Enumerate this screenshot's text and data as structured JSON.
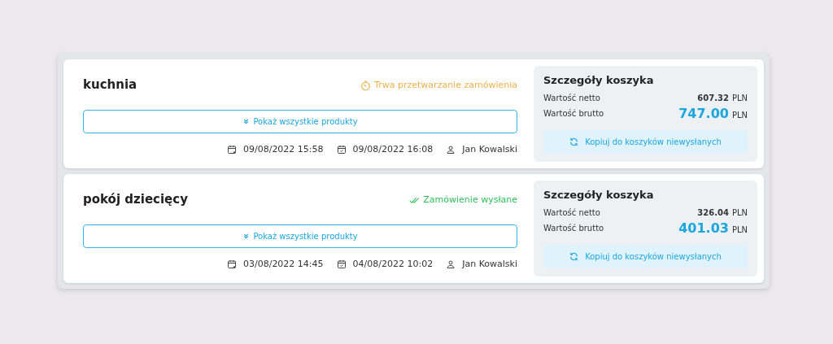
{
  "orders": [
    {
      "name": "kuchnia",
      "status": {
        "kind": "processing",
        "label": "Trwa przetwarzanie zamówienia"
      },
      "show_products": "Pokaż wszystkie produkty",
      "created": "09/08/2022 15:58",
      "sent": "09/08/2022 16:08",
      "user": "Jan Kowalski",
      "basket": {
        "title": "Szczegóły koszyka",
        "net_label": "Wartość netto",
        "net_value": "607.32",
        "net_currency": "PLN",
        "gross_label": "Wartość brutto",
        "gross_value": "747.00",
        "gross_currency": "PLN",
        "copy_button": "Kopiuj do koszyków niewysłanych"
      }
    },
    {
      "name": "pokój dziecięcy",
      "status": {
        "kind": "sent",
        "label": "Zamówienie wysłane"
      },
      "show_products": "Pokaż wszystkie produkty",
      "created": "03/08/2022 14:45",
      "sent": "04/08/2022 10:02",
      "user": "Jan Kowalski",
      "basket": {
        "title": "Szczegóły koszyka",
        "net_label": "Wartość netto",
        "net_value": "326.04",
        "net_currency": "PLN",
        "gross_label": "Wartość brutto",
        "gross_value": "401.03",
        "gross_currency": "PLN",
        "copy_button": "Kopiuj do koszyków niewysłanych"
      }
    }
  ]
}
